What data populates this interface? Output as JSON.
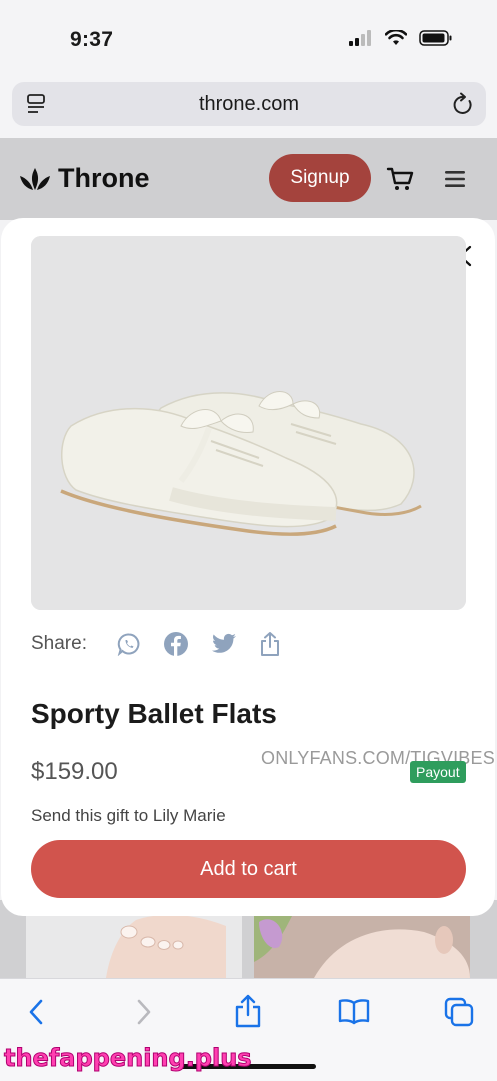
{
  "status": {
    "time": "9:37"
  },
  "browser": {
    "url": "throne.com"
  },
  "header": {
    "brand": "Throne",
    "signup_label": "Signup"
  },
  "product": {
    "share_label": "Share:",
    "share_icons": [
      "whatsapp-icon",
      "facebook-icon",
      "twitter-icon",
      "share-icon"
    ],
    "title": "Sporty Ballet Flats",
    "price": "$159.00",
    "payout_badge": "Payout",
    "gift_text": "Send this gift to Lily Marie",
    "add_to_cart_label": "Add to cart",
    "image_watermark": "ONLYFANS.COM/TIGVIBES"
  },
  "toolbar_icons": [
    "back-icon",
    "forward-icon",
    "share-icon",
    "bookmarks-icon",
    "tabs-icon"
  ],
  "site_watermark": "thefappening.plus",
  "colors": {
    "accent": "#d1544d",
    "signup": "#a4433d",
    "payout": "#2f9d5d",
    "ios_blue": "#1a73e8"
  }
}
